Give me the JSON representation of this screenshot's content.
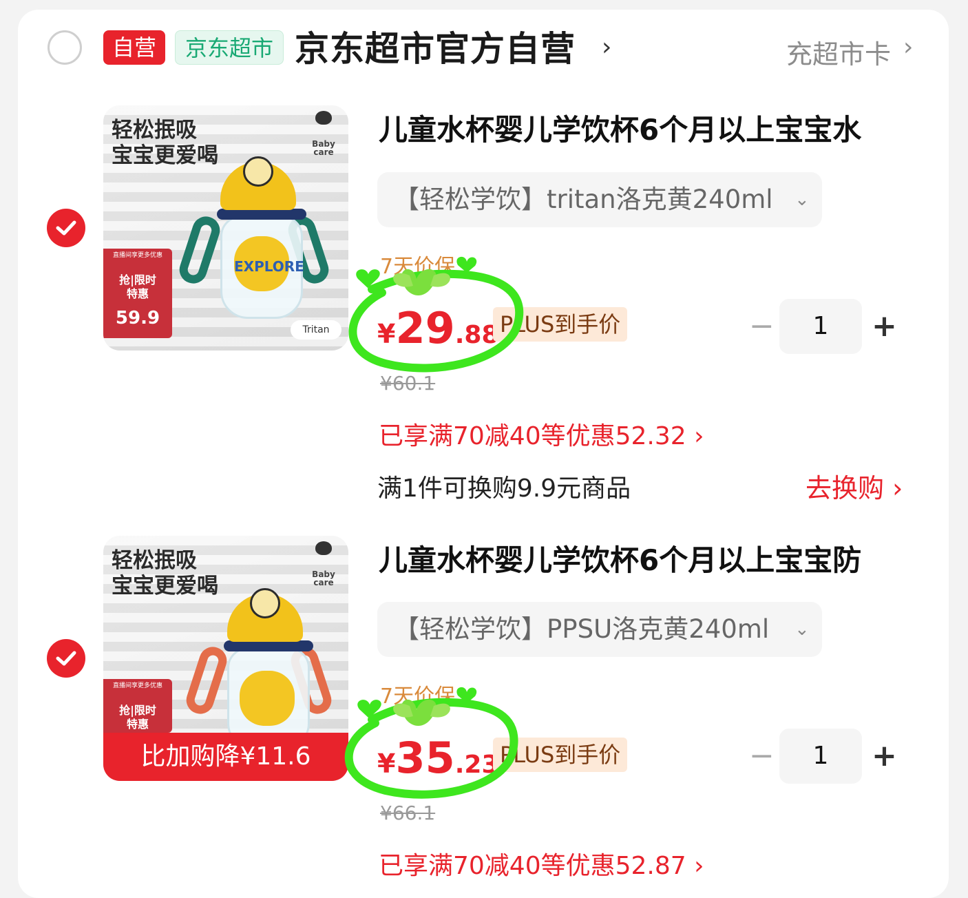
{
  "store": {
    "badge_self": "自营",
    "badge_market": "京东超市",
    "name": "京东超市官方自营",
    "chevron": "›",
    "card_link": "充超市卡",
    "card_chevron": "›"
  },
  "items": [
    {
      "title": "儿童水杯婴儿学饮杯6个月以上宝宝水",
      "spec": "【轻松学饮】tritan洛克黄240ml",
      "spec_chevron": "⌄",
      "protect": "7天价保",
      "price_currency": "¥",
      "price_int": "29",
      "price_dec": ".88",
      "plus_label": "PLUS到手价",
      "original_price": "¥60.1",
      "quantity": "1",
      "minus": "−",
      "plus": "+",
      "discount": "已享满70减40等优惠52.32 ›",
      "exchange": "满1件可换购9.9元商品",
      "exchange_link": "去换购 ›",
      "image": {
        "slogan_1": "轻松抿吸",
        "slogan_2": "宝宝更爱喝",
        "brand": "Baby care",
        "promo_small": "直播间享更多优惠",
        "promo_main_1": "抢|限时",
        "promo_main_2": "特惠",
        "promo_price": "59.9",
        "tag": "Tritan",
        "mascot_text": "EXPLORE"
      }
    },
    {
      "title": "儿童水杯婴儿学饮杯6个月以上宝宝防",
      "spec": "【轻松学饮】PPSU洛克黄240ml",
      "spec_chevron": "⌄",
      "protect": "7天价保",
      "price_currency": "¥",
      "price_int": "35",
      "price_dec": ".23",
      "plus_label": "PLUS到手价",
      "original_price": "¥66.1",
      "quantity": "1",
      "minus": "−",
      "plus": "+",
      "discount": "已享满70减40等优惠52.87 ›",
      "image": {
        "slogan_1": "轻松抿吸",
        "slogan_2": "宝宝更爱喝",
        "brand": "Baby care",
        "promo_small": "直播间享更多优惠",
        "promo_main_1": "抢|限时",
        "promo_main_2": "特惠",
        "banner": "比加购降¥11.6"
      }
    }
  ],
  "colors": {
    "accent": "#e8232c",
    "market_green": "#19a974",
    "marker_green": "#3ee61e"
  }
}
